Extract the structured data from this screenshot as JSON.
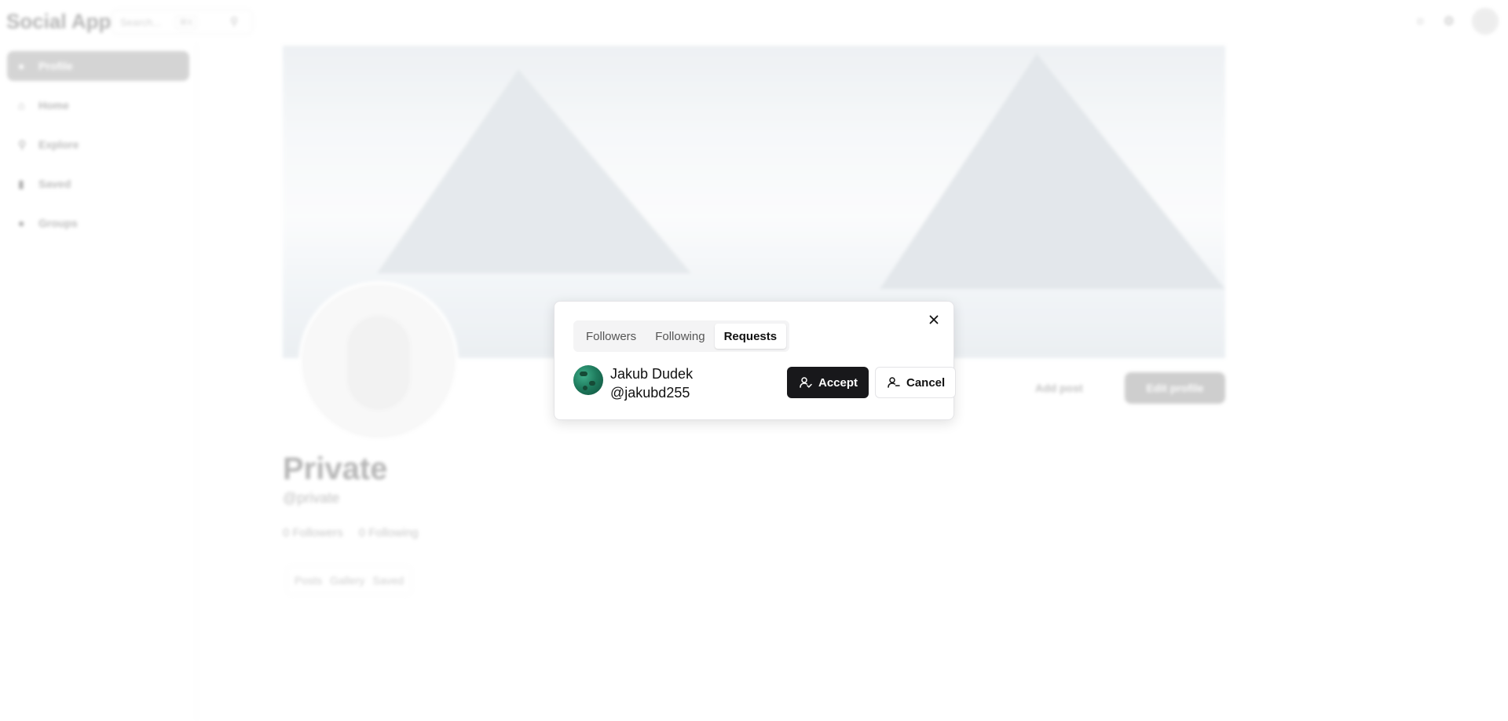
{
  "app": {
    "logo": "Social App",
    "search_placeholder": "Search...",
    "search_shortcut": "⌘K"
  },
  "sidebar": {
    "items": [
      {
        "label": "Profile",
        "icon": "user-icon"
      },
      {
        "label": "Home",
        "icon": "home-icon"
      },
      {
        "label": "Explore",
        "icon": "search-icon"
      },
      {
        "label": "Saved",
        "icon": "bookmark-icon"
      },
      {
        "label": "Groups",
        "icon": "users-icon"
      }
    ]
  },
  "profile": {
    "name": "Private",
    "handle": "@private",
    "followers": "0 Followers",
    "following": "0 Following",
    "add_post": "Add post",
    "edit_profile": "Edit profile",
    "tabs": [
      "Posts",
      "Gallery",
      "Saved"
    ]
  },
  "modal": {
    "tabs": [
      "Followers",
      "Following",
      "Requests"
    ],
    "active_tab": "Requests",
    "request": {
      "name": "Jakub Dudek",
      "handle": "@jakubd255",
      "accept_label": "Accept",
      "cancel_label": "Cancel"
    }
  },
  "colors": {
    "primary": "#18181b",
    "border": "#e4e4e7",
    "tab_bg": "#f4f4f5"
  }
}
